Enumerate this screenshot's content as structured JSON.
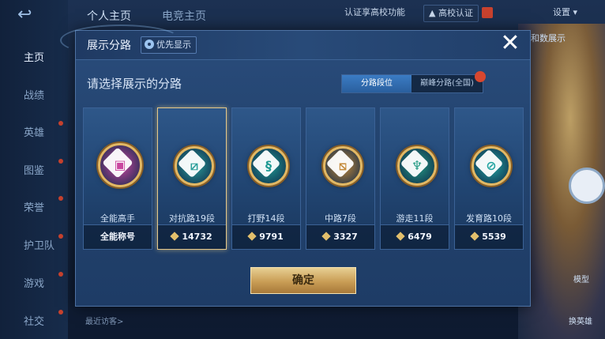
{
  "background": {
    "nav": {
      "back_label": "↩",
      "items": [
        {
          "label": "主页",
          "active": true,
          "dot": false
        },
        {
          "label": "战绩",
          "active": false,
          "dot": false
        },
        {
          "label": "英雄",
          "active": false,
          "dot": true
        },
        {
          "label": "图鉴",
          "active": false,
          "dot": true
        },
        {
          "label": "荣誉",
          "active": false,
          "dot": true
        },
        {
          "label": "护卫队",
          "active": false,
          "dot": true
        },
        {
          "label": "游戏",
          "active": false,
          "dot": true
        },
        {
          "label": "社交",
          "active": false,
          "dot": true
        }
      ]
    },
    "tabs": [
      "个人主页",
      "电竞主页"
    ],
    "top_right": {
      "verify_text": "认证享高校功能",
      "campus_btn": "高校认证",
      "settings_label": "设置"
    },
    "right_banner": "和数展示",
    "bottom_visitors": "最近访客>",
    "right_labels": {
      "fav": "模型",
      "hero_btn": "换英雄"
    }
  },
  "modal": {
    "title": "展示分路",
    "priority_button": "优先显示",
    "close_symbol": "✕",
    "subtitle": "请选择展示的分路",
    "switch": {
      "options": [
        "分路段位",
        "巅峰分路(全国)"
      ],
      "selected_index": 0
    },
    "cards": [
      {
        "name": "全能高手",
        "footer": "全能称号",
        "score": null,
        "icon": "allrounder-emblem-icon",
        "color": "#c9469f",
        "symbol": "▣",
        "selected": false
      },
      {
        "name": "对抗路19段",
        "footer": null,
        "score": "14732",
        "icon": "clash-lane-emblem-icon",
        "color": "#2a9e9a",
        "symbol": "⧄",
        "selected": true
      },
      {
        "name": "打野14段",
        "footer": null,
        "score": "9791",
        "icon": "jungle-emblem-icon",
        "color": "#1f9a93",
        "symbol": "§",
        "selected": false
      },
      {
        "name": "中路7段",
        "footer": null,
        "score": "3327",
        "icon": "mid-lane-emblem-icon",
        "color": "#c48a3a",
        "symbol": "⧅",
        "selected": false
      },
      {
        "name": "游走11段",
        "footer": null,
        "score": "6479",
        "icon": "roam-emblem-icon",
        "color": "#239a83",
        "symbol": "♆",
        "selected": false
      },
      {
        "name": "发育路10段",
        "footer": null,
        "score": "5539",
        "icon": "farm-lane-emblem-icon",
        "color": "#21a3a0",
        "symbol": "⊘",
        "selected": false
      }
    ],
    "confirm_label": "确定"
  }
}
